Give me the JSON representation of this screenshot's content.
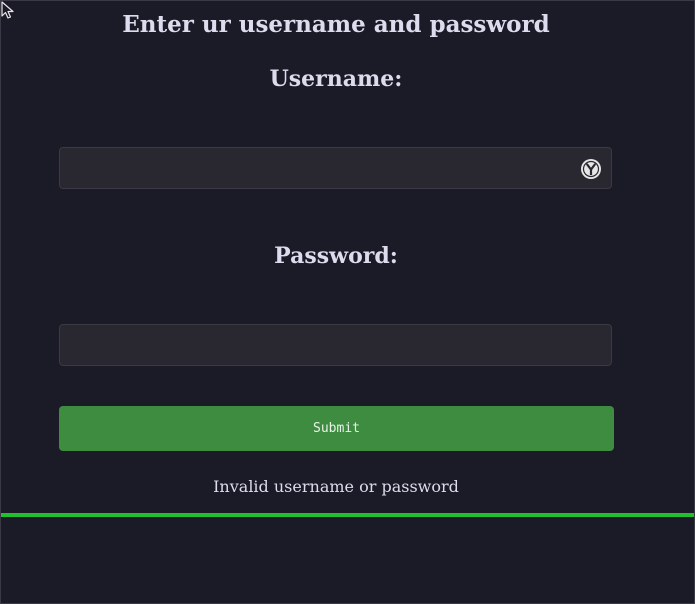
{
  "login": {
    "title": "Enter ur username and password",
    "username_label": "Username:",
    "username_value": "",
    "password_label": "Password:",
    "password_value": "",
    "submit_label": "Submit",
    "error_message": "Invalid username or password"
  },
  "icons": {
    "cursor": "mouse-pointer-icon",
    "password_manager": "password-manager-icon"
  },
  "progress": {
    "fraction": 1.0
  },
  "colors": {
    "background": "#1b1a27",
    "text": "#dcdcee",
    "field_background": "#292831",
    "submit_background": "#3e8c40",
    "progress_bar": "#22c02e"
  }
}
